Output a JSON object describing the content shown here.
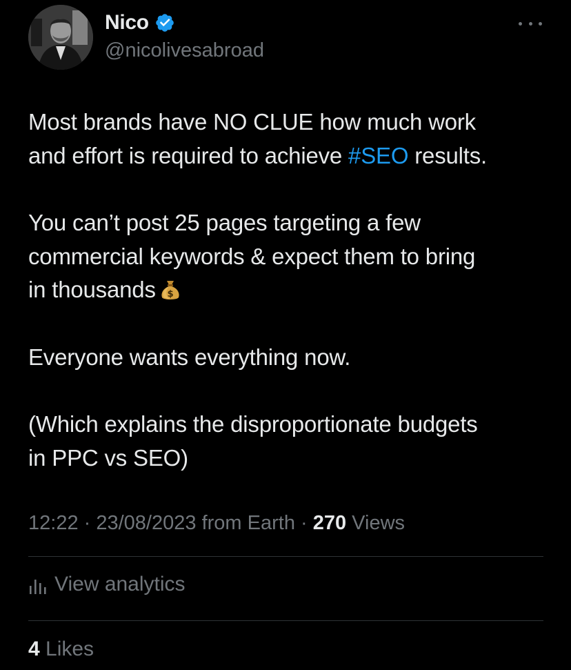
{
  "author": {
    "display_name": "Nico",
    "handle": "@nicolivesabroad",
    "verified": true,
    "verified_color": "#1d9bf0"
  },
  "tweet": {
    "paragraphs": [
      {
        "segments": [
          "Most brands have NO CLUE how much work",
          "and effort is required to achieve ",
          "#SEO",
          " results."
        ]
      },
      {
        "segments": [
          "You can’t post 25 pages targeting a few",
          "commercial keywords & expect them to bring",
          "in thousands"
        ],
        "trailing_emoji": "money-bag-icon"
      },
      {
        "segments": [
          "Everyone wants everything now."
        ]
      },
      {
        "segments": [
          "(Which explains the disproportionate budgets",
          "in PPC vs SEO)"
        ]
      }
    ],
    "hashtag_color": "#1d9bf0"
  },
  "meta": {
    "time": "12:22",
    "separator": " · ",
    "date": "23/08/2023",
    "source": " from Earth",
    "views_count": "270",
    "views_label": " Views"
  },
  "analytics": {
    "label": "View analytics",
    "icon": "bar-chart-icon"
  },
  "likes": {
    "count": "4",
    "label": " Likes"
  },
  "more_menu_icon": "more-options-icon",
  "colors": {
    "background": "#000000",
    "text": "#e7e9ea",
    "secondary_text": "#71767b",
    "divider": "#2f3336"
  }
}
